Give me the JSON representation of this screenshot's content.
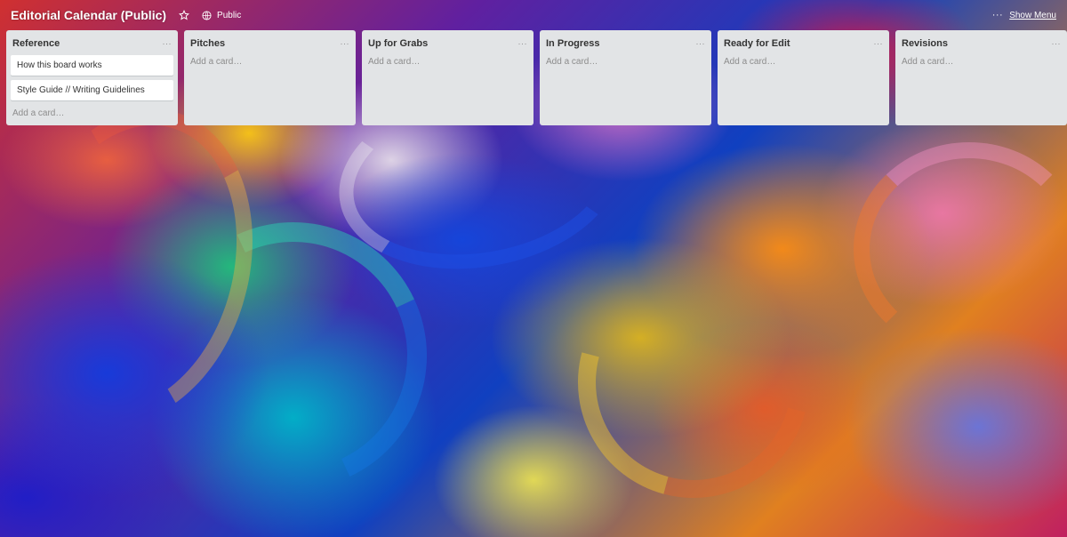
{
  "board": {
    "title": "Editorial Calendar (Public)",
    "visibility": "Public",
    "menu_label": "Show Menu",
    "menu_dots": "···",
    "star_icon": "star-icon",
    "globe_icon": "globe-icon"
  },
  "lists": [
    {
      "title": "Reference",
      "menu": "···",
      "cards": [
        "How this board works",
        "Style Guide // Writing Guidelines"
      ],
      "add_label": "Add a card…"
    },
    {
      "title": "Pitches",
      "menu": "···",
      "cards": [],
      "add_label": "Add a card…"
    },
    {
      "title": "Up for Grabs",
      "menu": "···",
      "cards": [],
      "add_label": "Add a card…"
    },
    {
      "title": "In Progress",
      "menu": "···",
      "cards": [],
      "add_label": "Add a card…"
    },
    {
      "title": "Ready for Edit",
      "menu": "···",
      "cards": [],
      "add_label": "Add a card…"
    },
    {
      "title": "Revisions",
      "menu": "···",
      "cards": [],
      "add_label": "Add a card…"
    }
  ],
  "colors": {
    "list_bg": "#e2e4e6",
    "card_bg": "#ffffff",
    "placeholder_text": "#8c8c8c"
  }
}
